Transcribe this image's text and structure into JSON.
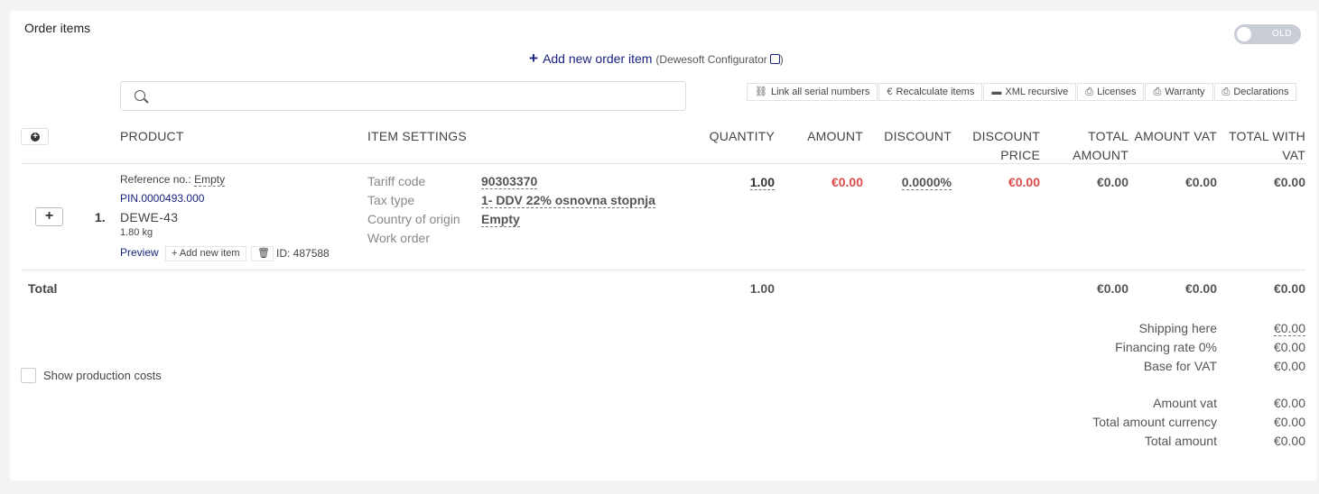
{
  "section_title": "Order items",
  "toggle_label": "OLD",
  "add_item": {
    "label": "Add new order item",
    "sub": "(Dewesoft Configurator",
    "close": ")"
  },
  "search": {
    "placeholder": ""
  },
  "toolbar": [
    {
      "icon": "link-icon",
      "glyph": "⛓",
      "label": "Link all serial numbers"
    },
    {
      "icon": "euro-icon",
      "glyph": "€",
      "label": "Recalculate items"
    },
    {
      "icon": "archive-icon",
      "glyph": "▬",
      "label": "XML recursive"
    },
    {
      "icon": "printer-icon",
      "glyph": "⎙",
      "label": "Licenses"
    },
    {
      "icon": "printer-icon",
      "glyph": "⎙",
      "label": "Warranty"
    },
    {
      "icon": "printer-icon",
      "glyph": "⎙",
      "label": "Declarations"
    }
  ],
  "columns": {
    "product": "PRODUCT",
    "item_settings": "ITEM SETTINGS",
    "quantity": "QUANTITY",
    "amount": "AMOUNT",
    "discount": "DISCOUNT",
    "discount_price_1": "DISCOUNT",
    "discount_price_2": "PRICE",
    "total_amount_1": "TOTAL",
    "total_amount_2": "AMOUNT",
    "amount_vat": "AMOUNT VAT",
    "total_vat_1": "TOTAL WITH",
    "total_vat_2": "VAT"
  },
  "item": {
    "index": "1.",
    "reference_label": "Reference no.:",
    "reference_value": "Empty",
    "pin": "PIN.0000493.000",
    "name": "DEWE-43",
    "weight": "1.80 kg",
    "preview": "Preview",
    "add_new_item": "Add new item",
    "id": "ID: 487588",
    "settings": [
      {
        "label": "Tariff code",
        "value": "90303370"
      },
      {
        "label": "Tax type",
        "value": "1- DDV 22% osnovna stopnja"
      },
      {
        "label": "Country of origin",
        "value": "Empty"
      },
      {
        "label": "Work order",
        "value": ""
      }
    ],
    "quantity": "1.00",
    "amount": "€0.00",
    "discount": "0.0000%",
    "discount_price": "€0.00",
    "total_amount": "€0.00",
    "amount_vat": "€0.00",
    "total_with_vat": "€0.00"
  },
  "total_row": {
    "label": "Total",
    "quantity": "1.00",
    "total_amount": "€0.00",
    "amount_vat": "€0.00",
    "total_with_vat": "€0.00"
  },
  "show_production_costs": "Show production costs",
  "summary": [
    {
      "label": "Shipping here",
      "value": "€0.00"
    },
    {
      "label": "Financing rate 0%",
      "value": "€0.00"
    },
    {
      "label": "Base for VAT",
      "value": "€0.00"
    },
    {
      "label": "Amount vat",
      "value": "€0.00"
    },
    {
      "label": "Total amount currency",
      "value": "€0.00"
    },
    {
      "label": "Total amount",
      "value": "€0.00"
    }
  ]
}
